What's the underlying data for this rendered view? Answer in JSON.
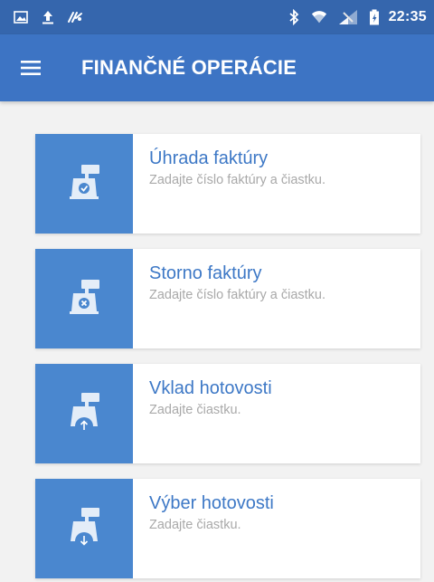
{
  "status_bar": {
    "time": "22:35",
    "icons": [
      "gallery-icon",
      "upload-icon",
      "tools-icon",
      "bluetooth-icon",
      "wifi-icon",
      "signal-icon",
      "battery-icon"
    ]
  },
  "app_bar": {
    "title": "FINANČNÉ OPERÁCIE",
    "menu_icon": "hamburger-menu-icon"
  },
  "colors": {
    "status_bar": "#3566ad",
    "app_bar": "#3d74c4",
    "icon_box": "#4a87cf",
    "title_text": "#3d78c6",
    "subtitle_text": "#a9a9a9",
    "background": "#f2f2f2"
  },
  "operations": [
    {
      "title": "Úhrada faktúry",
      "subtitle": "Zadajte číslo faktúry a čiastku.",
      "icon": "cash-register-check-icon"
    },
    {
      "title": "Storno faktúry",
      "subtitle": "Zadajte číslo faktúry a čiastku.",
      "icon": "cash-register-cancel-icon"
    },
    {
      "title": "Vklad hotovosti",
      "subtitle": "Zadajte čiastku.",
      "icon": "cash-register-deposit-icon"
    },
    {
      "title": "Výber hotovosti",
      "subtitle": "Zadajte čiastku.",
      "icon": "cash-register-withdraw-icon"
    }
  ]
}
